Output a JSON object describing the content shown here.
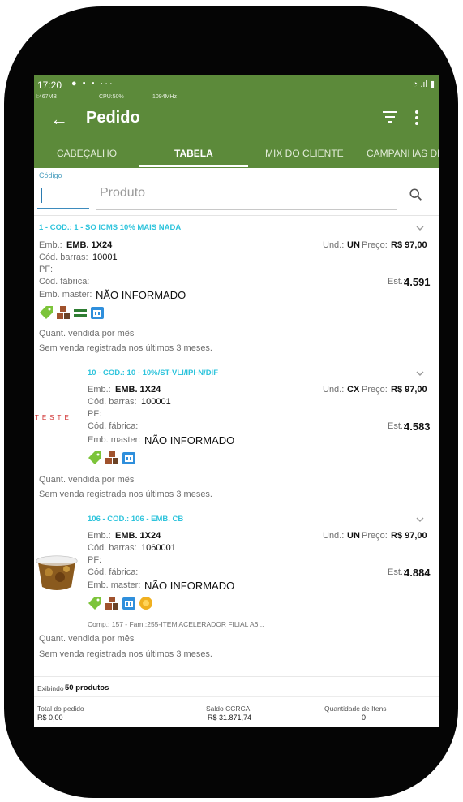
{
  "status_bar": {
    "time": "17:20",
    "debug_mem": "I:467MB",
    "debug_cpu": "CPU:50%",
    "debug_freq": "1094MHz"
  },
  "appbar": {
    "title": "Pedido"
  },
  "tabs": [
    {
      "label": "CABEÇALHO"
    },
    {
      "label": "TABELA"
    },
    {
      "label": "MIX DO CLIENTE"
    },
    {
      "label": "CAMPANHAS DE"
    }
  ],
  "search": {
    "codigo_label": "Código",
    "produto_placeholder": "Produto"
  },
  "labels": {
    "emb": "Emb.:",
    "cod_barras": "Cód. barras:",
    "pf": "PF:",
    "cod_fabrica": "Cód. fábrica:",
    "emb_master": "Emb. master:",
    "und": "Und.:",
    "preco": "Preço:",
    "est": "Est.:",
    "quant_vendida": "Quant. vendida por mês"
  },
  "products": [
    {
      "header": "1 - COD.: 1 - SO ICMS 10% MAIS NADA",
      "emb": "EMB. 1X24",
      "cod_barras": "10001",
      "emb_master": "NÃO INFORMADO",
      "und": "UN",
      "preco": "R$ 97,00",
      "est": "4.591",
      "sem_venda": "Sem venda registrada nos últimos 3 meses."
    },
    {
      "header": "10 - COD.: 10 - 10%/ST-VLI/IPI-N/DIF",
      "emb": "EMB. 1X24",
      "cod_barras": "100001",
      "emb_master": "NÃO INFORMADO",
      "und": "CX",
      "preco": "R$ 97,00",
      "est": "4.583",
      "image_text": "TESTE",
      "sem_venda": "Sem venda registrada nos últimos 3 meses."
    },
    {
      "header": "106 - COD.: 106 - EMB. CB",
      "emb": "EMB. 1X24",
      "cod_barras": "1060001",
      "emb_master": "NÃO INFORMADO",
      "und": "UN",
      "preco": "R$ 97,00",
      "est": "4.884",
      "extra": "Comp.: 157 - Fam.:255-ITEM ACELERADOR FILIAL A6...",
      "sem_venda": "Sem venda registrada nos últimos 3 meses."
    }
  ],
  "footer": {
    "exibindo_prefix": "Exibindo",
    "exibindo_count": "50 produtos",
    "total_label": "Total do pedido",
    "total_value": "R$ 0,00",
    "saldo_label": "Saldo CCRCA",
    "saldo_value": "R$ 31.871,74",
    "qtd_label": "Quantidade de Itens",
    "qtd_value": "0"
  },
  "colors": {
    "appbar": "#5c8a3a",
    "accent": "#2fc4dc",
    "link": "#3d8bbd"
  }
}
